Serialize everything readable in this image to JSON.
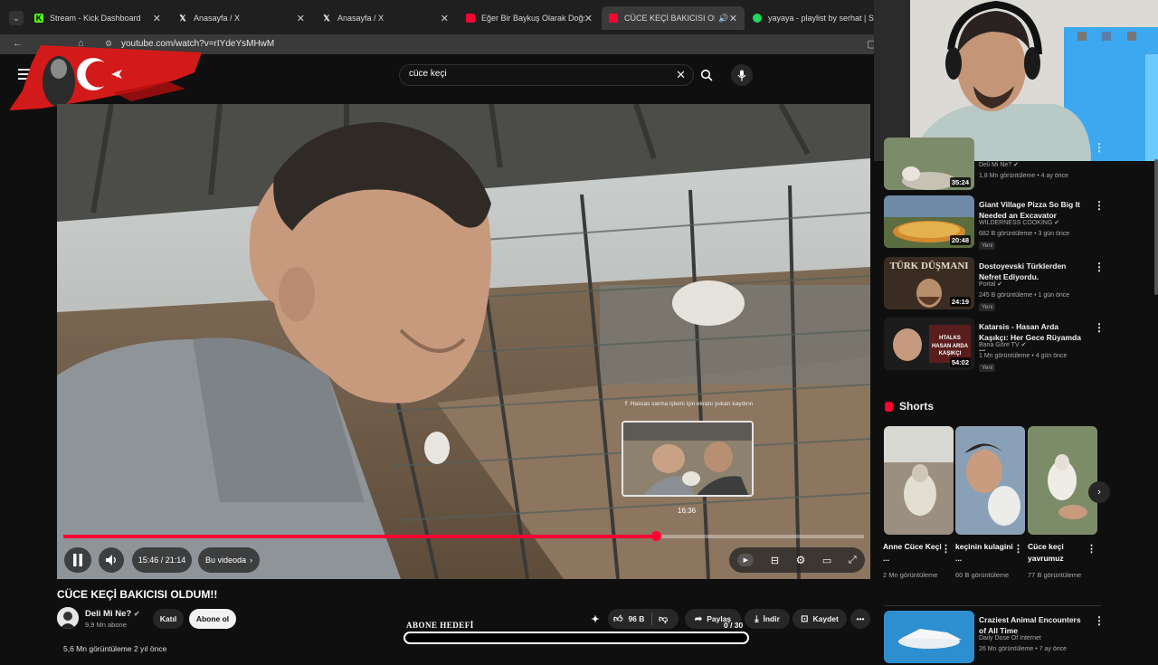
{
  "browser": {
    "tabs": [
      {
        "title": "Stream - Kick Dashboard",
        "icon": "kick-icon"
      },
      {
        "title": "Anasayfa / X",
        "icon": "x-icon"
      },
      {
        "title": "Anasayfa / X",
        "icon": "x-icon"
      },
      {
        "title": "Eğer Bir Baykuş Olarak Doğsaydın",
        "icon": "youtube-icon"
      },
      {
        "title": "CÜCE KEÇİ BAKICISI OLDUM!!",
        "icon": "youtube-icon"
      },
      {
        "title": "yayaya - playlist by serhat | Spo",
        "icon": "spotify-icon"
      }
    ],
    "url": "youtube.com/watch?v=rIYdeYsMHwM"
  },
  "search": {
    "value": "cüce keçi"
  },
  "player": {
    "preview_hint": "⇑ Hassas sarma işlemi için ekranı yukarı kaydırın",
    "preview_time": "16:36",
    "progress": 0.74,
    "time": "15:46 / 21:14",
    "chapter": "Bu videoda"
  },
  "video": {
    "title": "CÜCE KEÇİ BAKICISI OLDUM!!",
    "channel": "Deli Mi Ne?",
    "subs": "9,9 Mn abone",
    "join": "Katıl",
    "subscribe": "Abone ol",
    "likes": "96 B",
    "share": "Paylaş",
    "download": "İndir",
    "save": "Kaydet",
    "views": "5,6 Mn görüntüleme  2 yıl önce"
  },
  "overlay": {
    "goal_label": "ABONE HEDEFİ",
    "goal_count": "0 / 30",
    "goal_progress": 0
  },
  "recommendations": [
    {
      "title": "",
      "channel": "Deli Mi Ne?",
      "meta": "1,8 Mn görüntüleme • 4 ay önce",
      "duration": "35:24",
      "badge": ""
    },
    {
      "title": "Giant Village Pizza So Big It Needed an Excavator",
      "channel": "WILDERNESS COOKING",
      "meta": "682 B görüntüleme • 3 gün önce",
      "duration": "20:48",
      "badge": "Yeni"
    },
    {
      "title": "Dostoyevski Türklerden Nefret Ediyordu.",
      "channel": "Portal",
      "meta": "245 B görüntüleme • 1 gün önce",
      "duration": "24:19",
      "badge": "Yeni"
    },
    {
      "title": "Katarsis - Hasan Arda Kaşıkçı: Her Gece Rüyamda ...",
      "channel": "Bana Göre TV",
      "meta": "1 Mn görüntüleme • 4 gün önce",
      "duration": "54:02",
      "badge": "Yeni"
    }
  ],
  "shorts": {
    "heading": "Shorts",
    "items": [
      {
        "title": "Anne Cüce Keçi ...",
        "views": "2 Mn görüntüleme"
      },
      {
        "title": "keçinin kulagini ...",
        "views": "60 B görüntüleme"
      },
      {
        "title": "Cüce keçi yavrumuz",
        "views": "77 B görüntüleme"
      }
    ]
  },
  "bottom_rec": {
    "title": "Craziest Animal Encounters of All Time",
    "channel": "Daily Dose Of Internet",
    "meta": "26 Mn görüntüleme • 7 ay önce"
  }
}
